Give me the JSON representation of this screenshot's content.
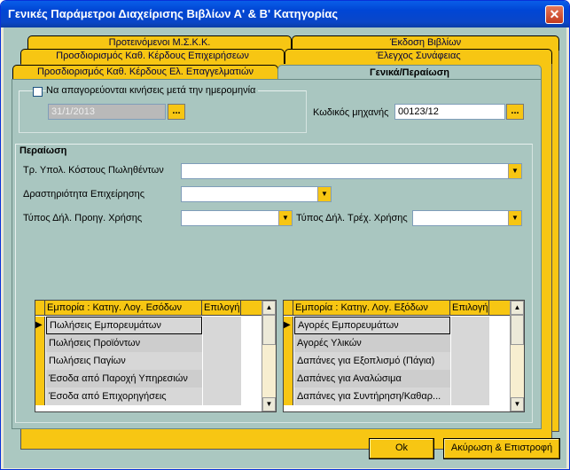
{
  "window": {
    "title": "Γενικές Παράμετροι Διαχείρισης Βιβλίων Α' & Β' Κατηγορίας",
    "close": "✕"
  },
  "tabs": {
    "row1": [
      "Προτεινόμενοι Μ.Σ.Κ.Κ.",
      "Έκδοση Βιβλίων"
    ],
    "row2": [
      "Προσδιορισμός Καθ. Κέρδους Επιχειρήσεων",
      "Έλεγχος Συνάφειας"
    ],
    "row3": [
      "Προσδιορισμός Καθ. Κέρδους Ελ. Επαγγελματιών",
      "Γενικά/Περαίωση"
    ]
  },
  "restrict": {
    "label": "Να απαγορεύονται κινήσεις μετά την ημερομηνία",
    "date": "31/1/2013",
    "checked": false,
    "dots": "..."
  },
  "machine": {
    "label": "Κωδικός μηχανής",
    "value": "00123/12",
    "dots": "..."
  },
  "peraiosi": {
    "title": "Περαίωση",
    "cost_label": "Τρ. Υπολ. Κόστους Πωληθέντων",
    "activity_label": "Δραστηριότητα Επιχείρησης",
    "prev_label": "Τύπος Δήλ. Προηγ. Χρήσης",
    "curr_label": "Τύπος Δήλ. Τρέχ. Χρήσης",
    "dd": "▼"
  },
  "grid_income": {
    "headers": [
      "Εμπορία : Κατηγ. Λογ. Εσόδων",
      "Επιλογή"
    ],
    "rows": [
      "Πωλήσεις Εμπορευμάτων",
      "Πωλήσεις Προϊόντων",
      "Πωλήσεις Παγίων",
      "Έσοδα από Παροχή Υπηρεσιών",
      "Έσοδα από Επιχορηγήσεις"
    ]
  },
  "grid_expense": {
    "headers": [
      "Εμπορία : Κατηγ. Λογ. Εξόδων",
      "Επιλογή"
    ],
    "rows": [
      "Αγορές Εμπορευμάτων",
      "Αγορές Υλικών",
      "Δαπάνες για Εξοπλισμό (Πάγια)",
      "Δαπάνες για Αναλώσιμα",
      "Δαπάνες για Συντήρηση/Καθαρ..."
    ]
  },
  "scroll": {
    "up": "▲",
    "down": "▼"
  },
  "row_pointer": "▶",
  "buttons": {
    "ok": "Ok",
    "cancel": "Ακύρωση & Επιστροφή"
  }
}
